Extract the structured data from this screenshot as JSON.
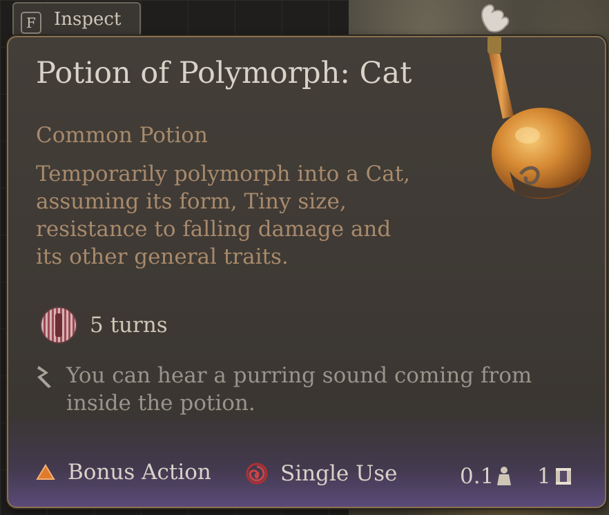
{
  "hint": {
    "key": "F",
    "label": "Inspect"
  },
  "item": {
    "name": "Potion of Polymorph: Cat",
    "rarity_type": "Common Potion",
    "description": "Temporarily polymorph into a Cat, assuming its form, Tiny size, resistance to falling damage and its other general traits.",
    "duration": "5 turns",
    "lore": "You can hear a purring sound coming from inside the potion."
  },
  "footer": {
    "action_cost": "Bonus Action",
    "usage": "Single Use",
    "weight": "0.1",
    "count": "1"
  },
  "icons": {
    "duration": "polymorph-condition-icon",
    "lore": "scroll-quill-icon",
    "action": "bonus-action-triangle-icon",
    "usage": "single-use-swirl-icon",
    "weight": "weight-icon",
    "count": "stack-count-icon",
    "item": "potion-flask-icon"
  },
  "colors": {
    "title": "#d8d2c8",
    "rarity": "#a88a6c",
    "border": "#8a7250",
    "bonus_action": "#e07a2e",
    "single_use": "#b03030"
  }
}
